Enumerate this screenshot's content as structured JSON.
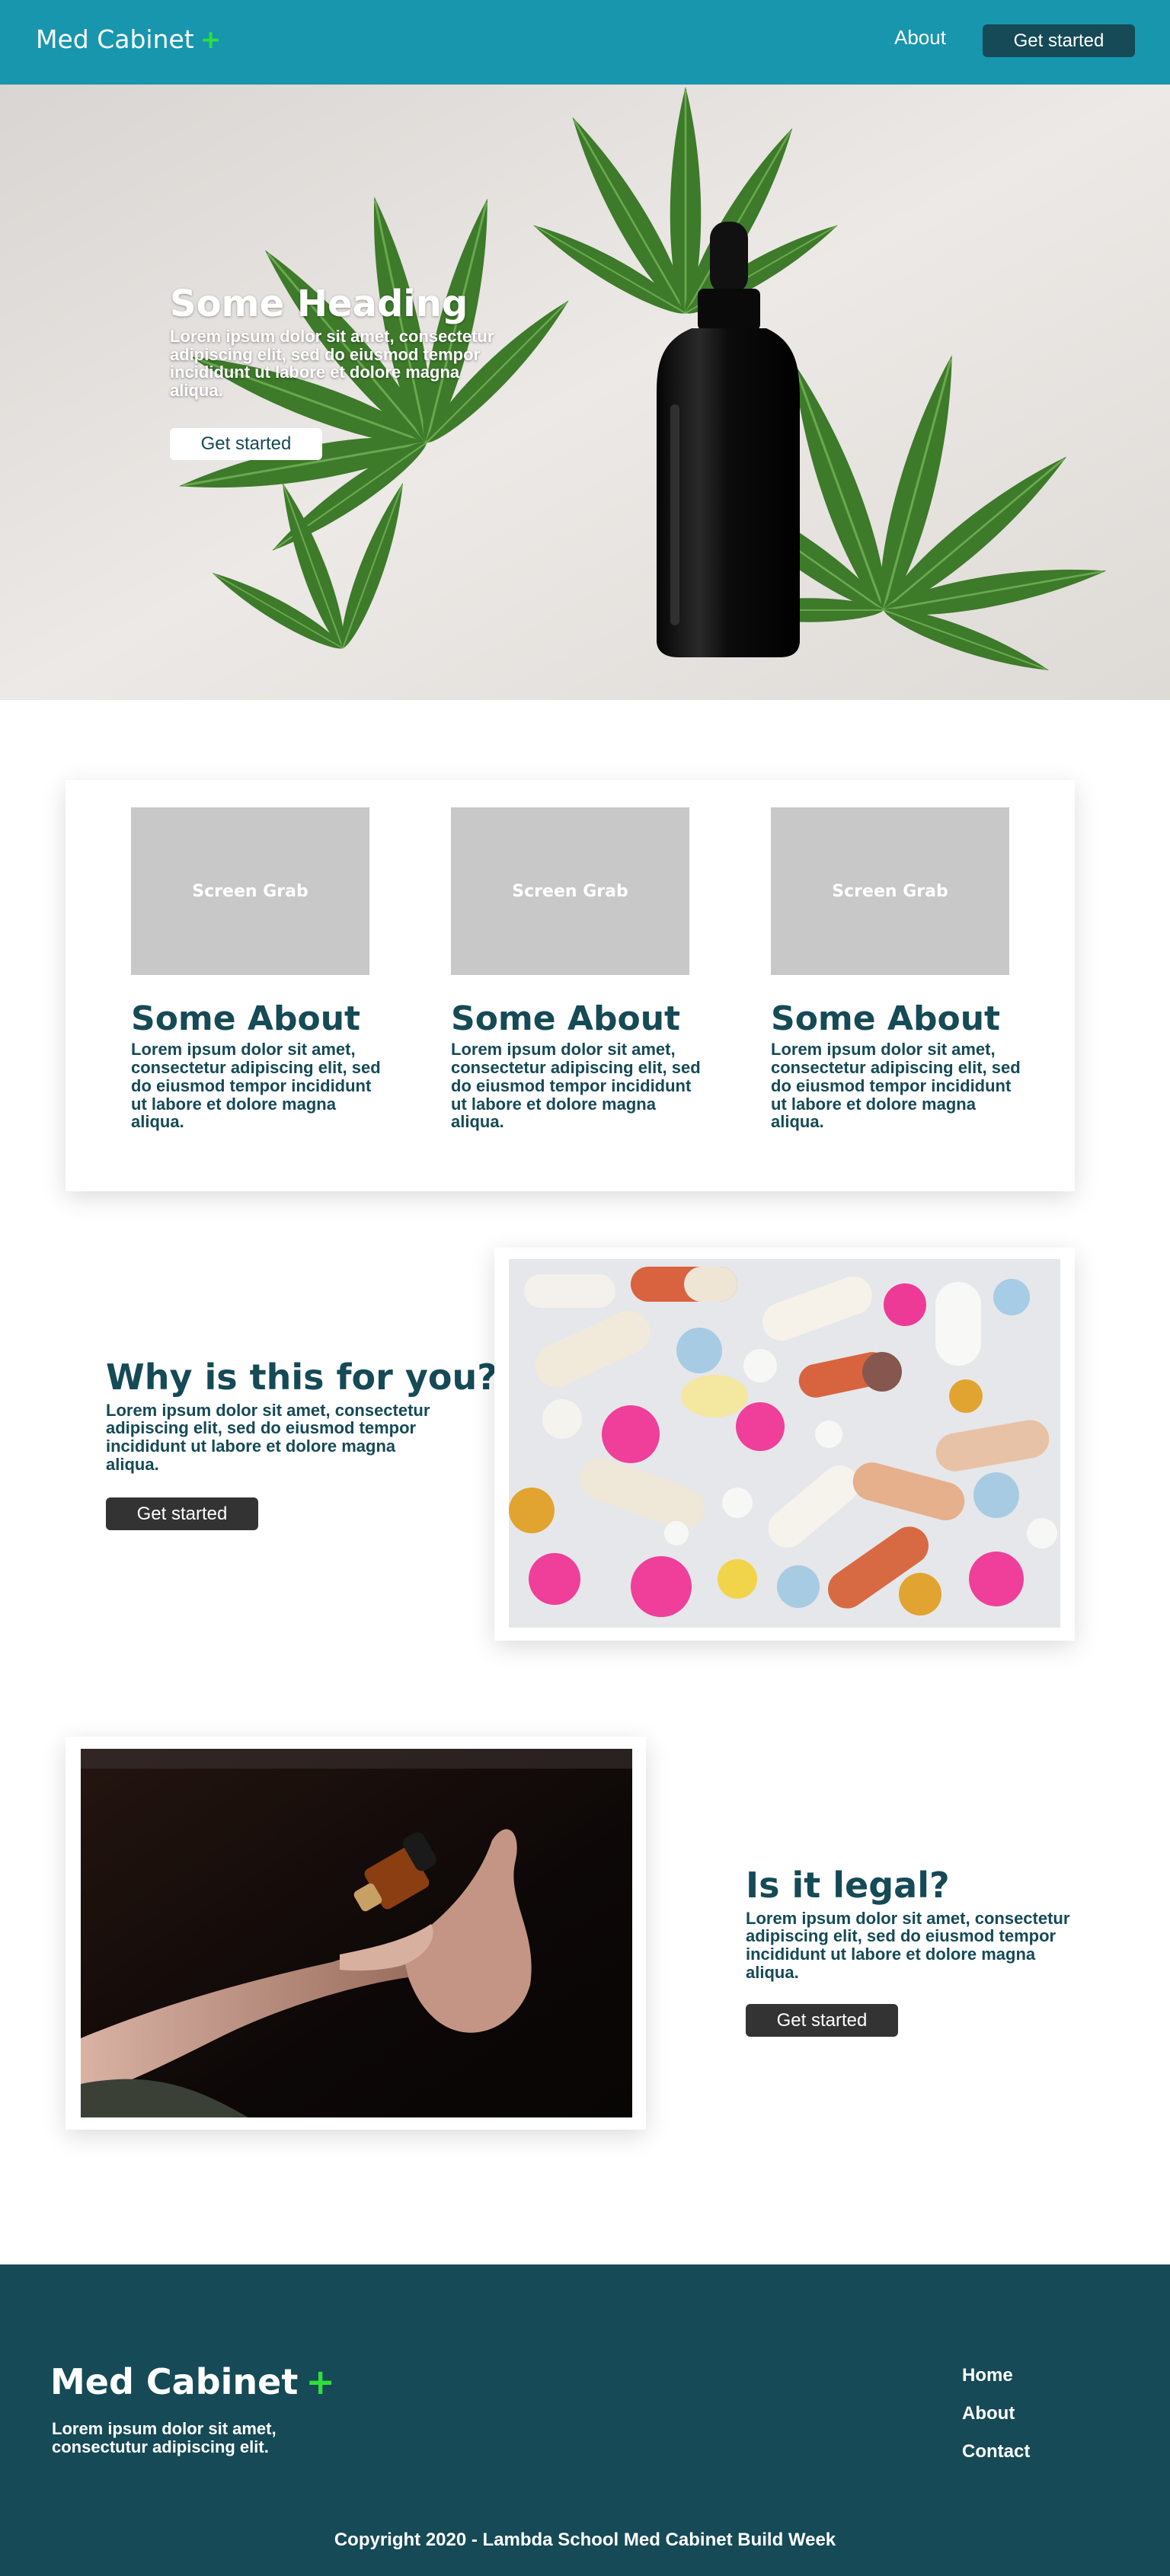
{
  "header": {
    "brand": "Med Cabinet",
    "brand_plus": "+",
    "nav_about": "About",
    "nav_cta": "Get started"
  },
  "hero": {
    "heading": "Some Heading",
    "body": "Lorem ipsum dolor sit amet, consectetur adipiscing elit, sed do eiusmod tempor incididunt ut labore et dolore magna aliqua.",
    "cta": "Get started"
  },
  "about_cards": [
    {
      "image_label": "Screen Grab",
      "title": "Some About",
      "body": "Lorem ipsum dolor sit amet, consectetur adipiscing elit, sed do eiusmod tempor incididunt ut labore et dolore magna aliqua."
    },
    {
      "image_label": "Screen Grab",
      "title": "Some About",
      "body": "Lorem ipsum dolor sit amet, consectetur adipiscing elit, sed do eiusmod tempor incididunt ut labore et dolore magna aliqua."
    },
    {
      "image_label": "Screen Grab",
      "title": "Some About",
      "body": "Lorem ipsum dolor sit amet, consectetur adipiscing elit, sed do eiusmod tempor incididunt ut labore et dolore magna aliqua."
    }
  ],
  "why_section": {
    "title": "Why is this for you?",
    "body": "Lorem ipsum dolor sit amet, consectetur adipiscing elit, sed do eiusmod tempor incididunt ut labore et dolore magna aliqua.",
    "cta": "Get started"
  },
  "legal_section": {
    "title": "Is it legal?",
    "body": "Lorem ipsum dolor sit amet, consectetur adipiscing elit, sed do eiusmod tempor incididunt ut labore et dolore magna aliqua.",
    "cta": "Get started"
  },
  "footer": {
    "brand": "Med Cabinet",
    "brand_plus": "+",
    "body": "Lorem ipsum dolor sit amet, consectutur adipiscing elit.",
    "links": [
      "Home",
      "About",
      "Contact"
    ],
    "copyright": "Copyright 2020 - Lambda School Med Cabinet Build Week"
  },
  "colors": {
    "header_bg": "#1796ae",
    "primary_dark": "#154a56",
    "accent_green": "#2fe03a",
    "button_dark": "#333333",
    "placeholder_gray": "#c8c8c8"
  },
  "icons": [
    "plus-icon"
  ]
}
